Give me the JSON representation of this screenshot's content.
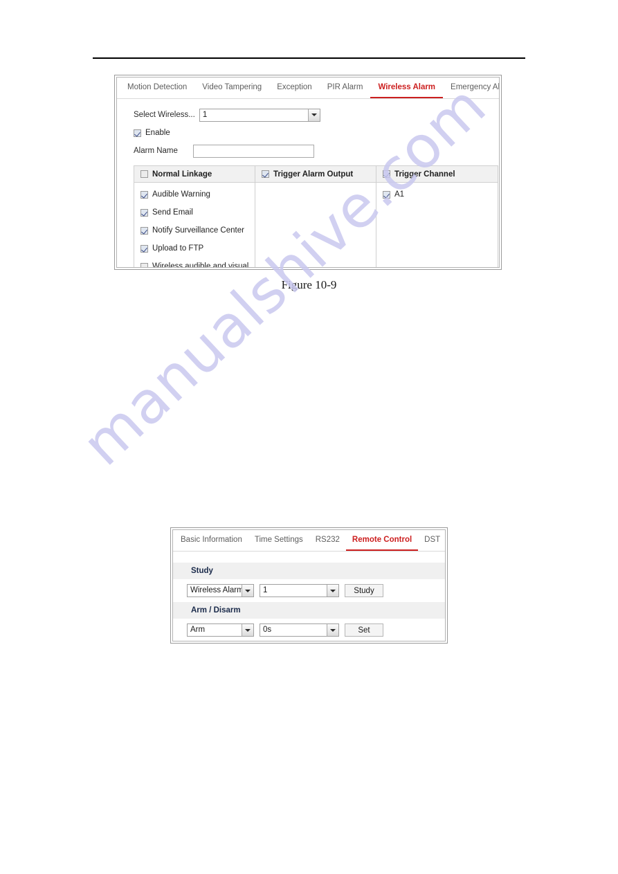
{
  "page": {
    "watermark": "manualshive.com",
    "watermark_color": "#c9c8ef",
    "accent_color": "#cc1f1f"
  },
  "figure_caption": "Figure 10-9",
  "alarm_panel": {
    "tabs": [
      {
        "label": "Motion Detection",
        "active": false
      },
      {
        "label": "Video Tampering",
        "active": false
      },
      {
        "label": "Exception",
        "active": false
      },
      {
        "label": "PIR Alarm",
        "active": false
      },
      {
        "label": "Wireless Alarm",
        "active": true
      },
      {
        "label": "Emergency Alarm",
        "active": false
      }
    ],
    "select_wireless": {
      "label": "Select Wireless...",
      "value": "1"
    },
    "enable": {
      "label": "Enable",
      "checked": true
    },
    "alarm_name": {
      "label": "Alarm Name",
      "value": "",
      "placeholder": ""
    },
    "linkage": {
      "normal_linkage": {
        "header": "Normal Linkage",
        "header_checked": false,
        "items": [
          {
            "label": "Audible Warning",
            "checked": true
          },
          {
            "label": "Send Email",
            "checked": true
          },
          {
            "label": "Notify Surveillance Center",
            "checked": true
          },
          {
            "label": "Upload to FTP",
            "checked": true
          },
          {
            "label": "Wireless audible and visual...",
            "checked": false
          }
        ]
      },
      "trigger_alarm_output": {
        "header": "Trigger Alarm Output",
        "header_checked": true,
        "items": []
      },
      "trigger_channel": {
        "header": "Trigger Channel",
        "header_checked": true,
        "items": [
          {
            "label": "A1",
            "checked": true
          }
        ]
      }
    }
  },
  "remote_panel": {
    "tabs": [
      {
        "label": "Basic Information",
        "active": false
      },
      {
        "label": "Time Settings",
        "active": false
      },
      {
        "label": "RS232",
        "active": false
      },
      {
        "label": "Remote Control",
        "active": true
      },
      {
        "label": "DST",
        "active": false
      }
    ],
    "study": {
      "header": "Study",
      "type_value": "Wireless Alarm",
      "number_value": "1",
      "button_label": "Study"
    },
    "arm_disarm": {
      "header": "Arm / Disarm",
      "mode_value": "Arm",
      "delay_value": "0s",
      "button_label": "Set"
    }
  }
}
